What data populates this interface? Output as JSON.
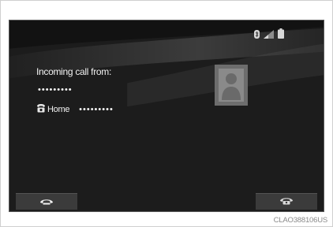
{
  "screen": {
    "status_icons": [
      "bluetooth-icon",
      "signal-strength-icon",
      "battery-icon"
    ]
  },
  "call": {
    "label": "Incoming call from:",
    "caller_number": "•••••••••",
    "home_label": "Home",
    "home_number": "•••••••••",
    "contact_photo": "person-silhouette-icon"
  },
  "buttons": {
    "accept_icon": "phone-answer-icon",
    "decline_icon": "phone-hangup-icon"
  },
  "caption": "CLAO388106US",
  "colors": {
    "screen_bg": "#1c1c1c",
    "text": "#f2f2f2",
    "button_bg": "#3b3b3b"
  }
}
